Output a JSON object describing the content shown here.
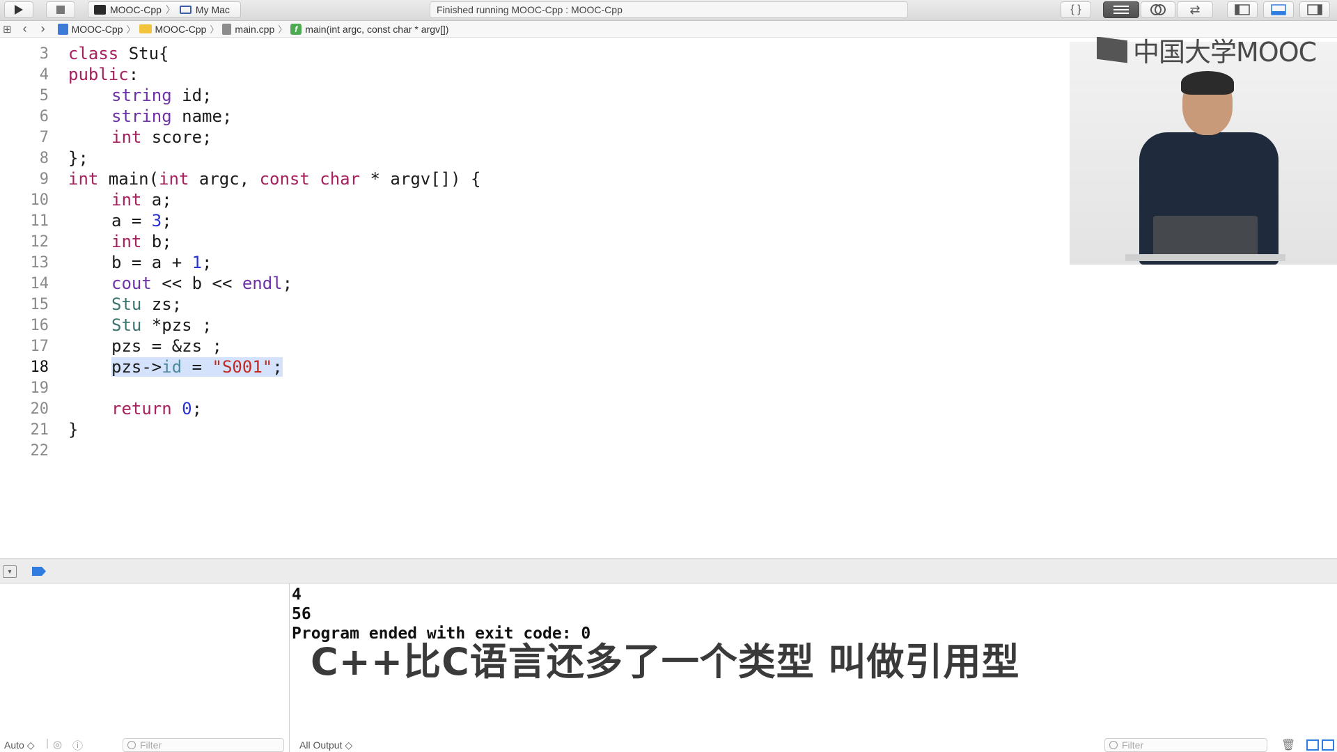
{
  "toolbar": {
    "run_icon": "play-icon",
    "stop_icon": "stop-icon",
    "scheme": {
      "project": "MOOC-Cpp",
      "destination": "My Mac"
    },
    "activity_status": "Finished running MOOC-Cpp : MOOC-Cpp",
    "right_icons": [
      "braces-icon",
      "standard-editor-icon",
      "assistant-editor-icon",
      "version-editor-icon",
      "navigator-toggle-icon",
      "debug-area-toggle-icon",
      "inspector-toggle-icon"
    ]
  },
  "jumpbar": {
    "crumbs": [
      "MOOC-Cpp",
      "MOOC-Cpp",
      "main.cpp",
      "main(int argc, const char * argv[])"
    ]
  },
  "editor": {
    "current_line": 18,
    "lines": [
      {
        "n": "3"
      },
      {
        "n": "4"
      },
      {
        "n": "5"
      },
      {
        "n": "6"
      },
      {
        "n": "7"
      },
      {
        "n": "8"
      },
      {
        "n": "9"
      },
      {
        "n": "10"
      },
      {
        "n": "11"
      },
      {
        "n": "12"
      },
      {
        "n": "13"
      },
      {
        "n": "14"
      },
      {
        "n": "15"
      },
      {
        "n": "16"
      },
      {
        "n": "17"
      },
      {
        "n": "18"
      },
      {
        "n": "19"
      },
      {
        "n": "20"
      },
      {
        "n": "21"
      },
      {
        "n": "22"
      }
    ],
    "code": {
      "l3": [
        "class",
        " Stu{"
      ],
      "l4": [
        "public",
        ":"
      ],
      "l5": [
        "string",
        " id;"
      ],
      "l6": [
        "string",
        " name;"
      ],
      "l7": [
        "int",
        " score;"
      ],
      "l8": [
        "};"
      ],
      "l9": [
        "int",
        " main(",
        "int",
        " argc, ",
        "const",
        " ",
        "char",
        " * argv[]) {"
      ],
      "l10": [
        "int",
        " a;"
      ],
      "l11": [
        "a = ",
        "3",
        ";"
      ],
      "l12": [
        "int",
        " b;"
      ],
      "l13": [
        "b = a + ",
        "1",
        ";"
      ],
      "l14": [
        "cout",
        " << b << ",
        "endl",
        ";"
      ],
      "l15": [
        "Stu",
        " zs;"
      ],
      "l16": [
        "Stu",
        " *pzs ;"
      ],
      "l17": [
        "pzs = &zs ;"
      ],
      "l18": [
        "pzs->",
        "id",
        " = ",
        "\"S001\"",
        ";"
      ],
      "l20": [
        "return",
        " ",
        "0",
        ";"
      ],
      "l21": [
        "}"
      ]
    }
  },
  "video": {
    "logo_text": "中国大学MOOC"
  },
  "console": {
    "output": [
      "4",
      "56",
      "Program ended with exit code: 0"
    ],
    "caption": "C++比C语言还多了一个类型 叫做引用型"
  },
  "footer": {
    "variables_mode": "Auto ◇",
    "variables_filter_placeholder": "Filter",
    "output_mode": "All Output ◇",
    "console_filter_placeholder": "Filter"
  },
  "colors": {
    "keyword": "#a6215e",
    "type": "#6d31a8",
    "class": "#3b7670",
    "number": "#2633d2",
    "string": "#c22a21",
    "selection": "#d4e3fb"
  }
}
